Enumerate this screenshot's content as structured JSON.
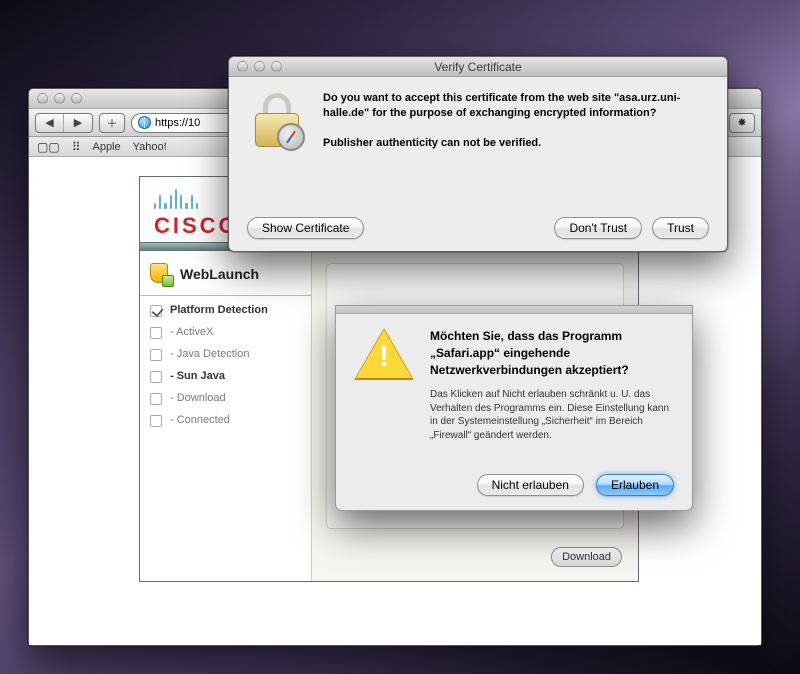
{
  "safari": {
    "toolbar": {
      "back_glyph": "◀",
      "forward_glyph": "▶",
      "add_glyph": "＋",
      "reload_glyph": "↻",
      "newtab_glyph": "＋",
      "bug_glyph": "✸",
      "url": "https://10"
    },
    "bookmarks": {
      "book_icon": "▢▢",
      "grid_icon": "⠿",
      "items": [
        "Apple",
        "Yahoo!"
      ]
    }
  },
  "page": {
    "brand": "CISCO",
    "weblaunch": "WebLaunch",
    "checklist": {
      "items": [
        {
          "label": "Platform Detection",
          "checked": true,
          "active": true
        },
        {
          "label": "- ActiveX",
          "checked": false,
          "active": false
        },
        {
          "label": "- Java Detection",
          "checked": false,
          "active": false
        },
        {
          "label": "- Sun Java",
          "checked": false,
          "active": true
        },
        {
          "label": "- Download",
          "checked": false,
          "active": false
        },
        {
          "label": "- Connected",
          "checked": false,
          "active": false
        }
      ]
    },
    "download_label": "Download"
  },
  "cert_dialog": {
    "title": "Verify Certificate",
    "line1": "Do you want to accept this certificate from the web site \"asa.urz.uni-halle.de\" for the purpose of exchanging encrypted information?",
    "line2": "Publisher authenticity can not be verified.",
    "show_cert": "Show Certificate",
    "dont_trust": "Don't Trust",
    "trust": "Trust"
  },
  "fw_sheet": {
    "heading": "Möchten Sie, dass das Programm „Safari.app“ eingehende Netzwerkverbindungen akzeptiert?",
    "body": "Das Klicken auf Nicht erlauben schränkt u. U. das Verhalten des Programms ein. Diese Einstellung kann in der Systemeinstellung „Sicherheit“ im Bereich „Firewall“ geändert werden.",
    "deny": "Nicht erlauben",
    "allow": "Erlauben"
  }
}
